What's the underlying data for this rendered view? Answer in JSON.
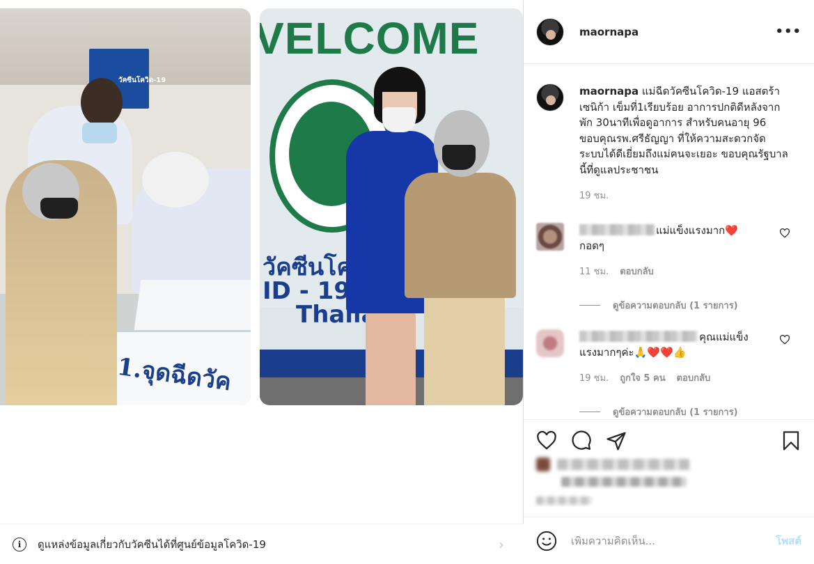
{
  "post": {
    "username": "maornapa",
    "more_icon": "more-horizontal-icon",
    "photos": {
      "right_welcome_text": "VELCOME",
      "right_thai_line1": "วัคซีนโควิ",
      "right_thai_line2": "ID - 19 V",
      "right_thai_line3": "Thaila",
      "left_banner_text": "วัคซีนโควิด-19",
      "left_sign_text": "1.จุดฉีดวัค"
    },
    "info_bar": {
      "icon": "info-icon",
      "text": "ดูแหล่งข้อมูลเกี่ยวกับวัคซีนได้ที่ศูนย์ข้อมูลโควิด-19",
      "chevron": "›"
    }
  },
  "caption": {
    "username": "maornapa",
    "text": " แม่ฉีดวัคซีนโควิด-19 แอสตร้าเซนิก้า เข็มที่1เรียบร้อย อาการปกติดีหลังจากพัก 30นาทีเพื่อดูอาการ สำหรับคนอายุ 96 ขอบคุณรพ.ศรีธัญญา ที่ให้ความสะดวกจัดระบบได้ดีเยี่ยมถึงแม่คนจะเยอะ ขอบคุณรัฐบาลนี้ที่ดูแลประชาชน",
    "time": "19 ชม."
  },
  "comments": [
    {
      "text": "แม่แข็งแรงมาก❤️ กอดๆ",
      "time": "11 ชม.",
      "reply_label": "ตอบกลับ",
      "likes_label": "",
      "view_replies": "ดูข้อความตอบกลับ (1 รายการ)"
    },
    {
      "text": "คุณแม่แข็งแรงมากๆค่ะ🙏❤️❤️👍",
      "time": "19 ชม.",
      "likes_label": "ถูกใจ 5 คน",
      "reply_label": "ตอบกลับ",
      "view_replies": "ดูข้อความตอบกลับ (1 รายการ)"
    }
  ],
  "actions": {
    "like_icon": "heart-icon",
    "comment_icon": "comment-icon",
    "share_icon": "share-icon",
    "save_icon": "bookmark-icon"
  },
  "add_comment": {
    "emoji_icon": "emoji-icon",
    "placeholder": "เพิ่มความคิดเห็น...",
    "post_label": "โพสต์"
  },
  "colors": {
    "post_button_disabled": "#b2dffc",
    "meta_gray": "#8e8e8e",
    "heart_red": "#ed4956"
  }
}
